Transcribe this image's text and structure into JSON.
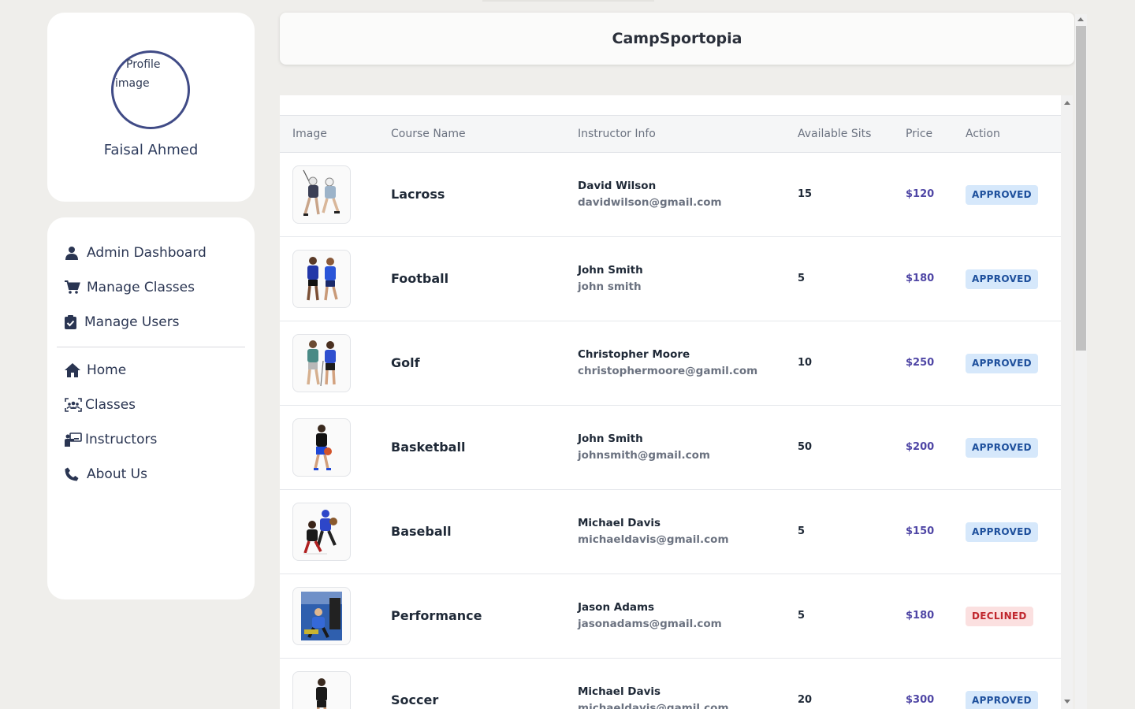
{
  "app": {
    "title": "CampSportopia"
  },
  "profile": {
    "image_alt": "Profile image",
    "name": "Faisal Ahmed"
  },
  "sidebar": {
    "admin_items": [
      {
        "label": "Admin Dashboard",
        "icon": "user-icon"
      },
      {
        "label": "Manage Classes",
        "icon": "cart-icon"
      },
      {
        "label": "Manage Users",
        "icon": "clipboard-check-icon"
      }
    ],
    "public_items": [
      {
        "label": "Home",
        "icon": "home-icon"
      },
      {
        "label": "Classes",
        "icon": "group-icon"
      },
      {
        "label": "Instructors",
        "icon": "chalkboard-teacher-icon"
      },
      {
        "label": "About Us",
        "icon": "phone-icon"
      }
    ]
  },
  "table": {
    "columns": [
      "Image",
      "Course Name",
      "Instructor Info",
      "Available Sits",
      "Price",
      "Action"
    ],
    "rows": [
      {
        "course": "Lacross",
        "instructor": "David Wilson",
        "email": "davidwilson@gmail.com",
        "seats": "15",
        "price": "$120",
        "status": "APPROVED",
        "image_icon": "lacrosse-players-image"
      },
      {
        "course": "Football",
        "instructor": "John Smith",
        "email": "john smith",
        "seats": "5",
        "price": "$180",
        "status": "APPROVED",
        "image_icon": "football-players-image"
      },
      {
        "course": "Golf",
        "instructor": "Christopher Moore",
        "email": "christophermoore@gamil.com",
        "seats": "10",
        "price": "$250",
        "status": "APPROVED",
        "image_icon": "golf-players-image"
      },
      {
        "course": "Basketball",
        "instructor": "John Smith",
        "email": "johnsmith@gmail.com",
        "seats": "50",
        "price": "$200",
        "status": "APPROVED",
        "image_icon": "basketball-player-image"
      },
      {
        "course": "Baseball",
        "instructor": "Michael Davis",
        "email": "michaeldavis@gmail.com",
        "seats": "5",
        "price": "$150",
        "status": "APPROVED",
        "image_icon": "baseball-players-image"
      },
      {
        "course": "Performance",
        "instructor": "Jason Adams",
        "email": "jasonadams@gmail.com",
        "seats": "5",
        "price": "$180",
        "status": "DECLINED",
        "image_icon": "performance-training-image"
      },
      {
        "course": "Soccer",
        "instructor": "Michael Davis",
        "email": "michaeldavis@gamil.com",
        "seats": "20",
        "price": "$300",
        "status": "APPROVED",
        "image_icon": "soccer-player-image"
      }
    ]
  },
  "colors": {
    "accent": "#404b86",
    "price": "#4f46a5",
    "approved_bg": "#d6e8fb",
    "approved_text": "#1d4f9c",
    "declined_bg": "#fbe0e0",
    "declined_text": "#c0262d",
    "page_bg": "#efeeeb"
  }
}
